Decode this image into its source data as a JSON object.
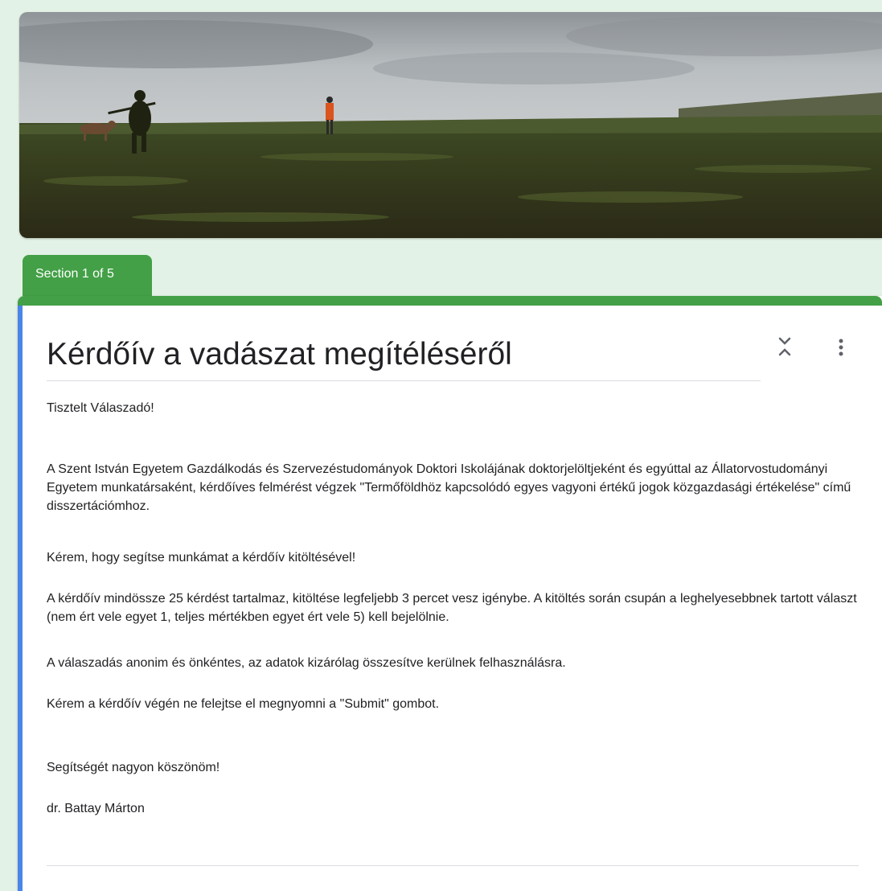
{
  "header": {
    "image_alt": "hunting field landscape"
  },
  "section": {
    "tab_label": "Section 1 of 5"
  },
  "form": {
    "title": "Kérdőív a vadászat megítéléséről",
    "description": {
      "greeting": "Tisztelt Válaszadó!",
      "para1": "A Szent István Egyetem Gazdálkodás és Szervezéstudományok Doktori Iskolájának doktorjelöltjeként és egyúttal az Állatorvostudományi Egyetem munkatársaként, kérdőíves felmérést végzek \"Termőföldhöz kapcsolódó egyes vagyoni értékű jogok közgazdasági értékelése\" című disszertációmhoz.",
      "request": "Kérem, hogy segítse munkámat a kérdőív kitöltésével!",
      "para2": "A kérdőív mindössze 25 kérdést tartalmaz, kitöltése legfeljebb 3 percet vesz igénybe. A kitöltés során csupán a leghelyesebbnek tartott választ (nem ért vele egyet 1, teljes mértékben egyet ért vele 5) kell bejelölnie.",
      "anonymity": "A válaszadás anonim és önkéntes, az adatok kizárólag összesítve kerülnek felhasználásra.",
      "submit_reminder": "Kérem a kérdőív végén ne felejtse el megnyomni a \"Submit\" gombot.",
      "thanks": "Segítségét nagyon köszönöm!",
      "signature": "dr. Battay Márton"
    }
  },
  "icons": {
    "collapse": "collapse-icon",
    "more": "more-vert-icon"
  },
  "colors": {
    "background": "#e3f2e6",
    "theme_green": "#43a047",
    "accent_blue": "#4a86e8",
    "text": "#202124"
  }
}
